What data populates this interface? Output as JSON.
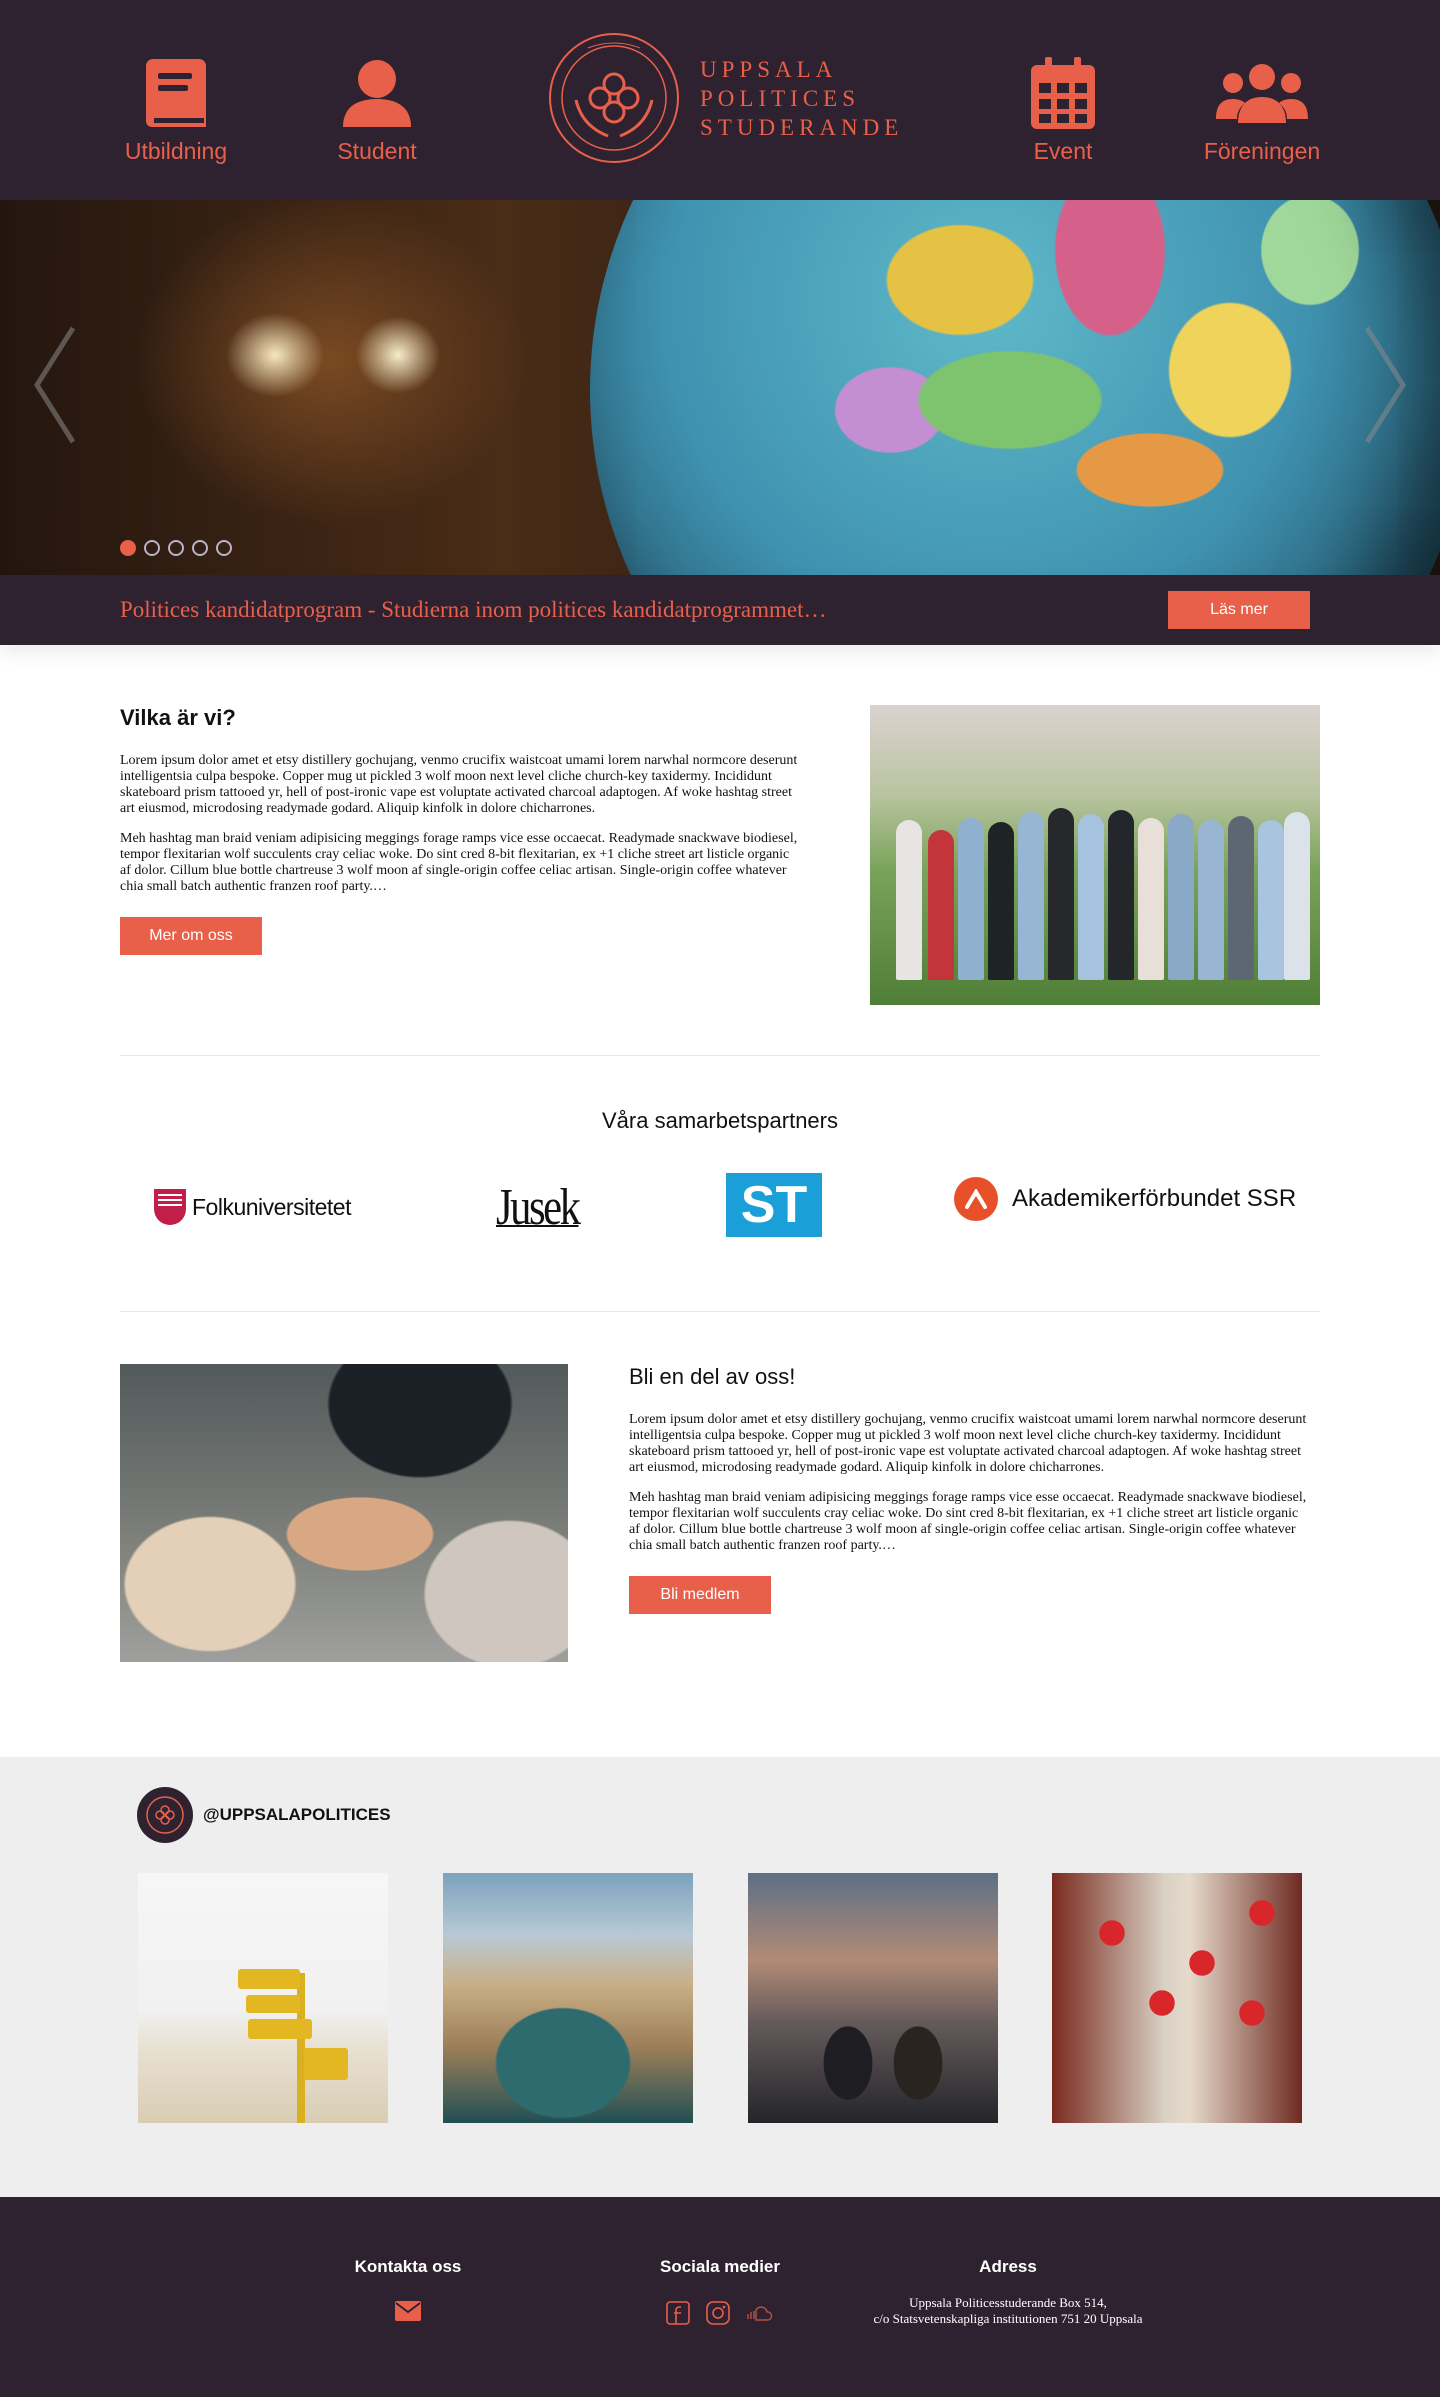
{
  "header": {
    "nav_left": [
      {
        "label": "Utbildning",
        "icon": "book-icon"
      },
      {
        "label": "Student",
        "icon": "user-icon"
      }
    ],
    "nav_right": [
      {
        "label": "Event",
        "icon": "calendar-icon"
      },
      {
        "label": "Föreningen",
        "icon": "group-icon"
      }
    ],
    "logo": {
      "line1": "UPPSALA",
      "line2": "POLITICES",
      "line3": "STUDERANDE"
    }
  },
  "hero": {
    "slide_count": 5,
    "active_slide": 1,
    "caption": "Politices kandidatprogram - Studierna inom politices kandidatprogrammet…",
    "read_more": "Läs mer"
  },
  "about": {
    "title": "Vilka är vi?",
    "p1": "Lorem ipsum dolor amet et etsy distillery gochujang, venmo crucifix waistcoat umami lorem narwhal normcore deserunt intelligentsia culpa bespoke. Copper mug ut pickled 3 wolf moon next level cliche church-key taxidermy. Incididunt skateboard prism tattooed yr, hell of post-ironic vape est voluptate activated charcoal adaptogen. Af woke hashtag street art eiusmod, microdosing readymade godard. Aliquip kinfolk in dolore chicharrones.",
    "p2": "Meh hashtag man braid veniam adipisicing meggings forage ramps vice esse occaecat. Readymade snackwave biodiesel, tempor flexitarian wolf succulents cray celiac woke. Do sint cred 8-bit flexitarian, ex +1 cliche street art listicle organic af dolor. Cillum blue bottle chartreuse 3 wolf moon af single-origin coffee celiac artisan. Single-origin coffee whatever chia small batch authentic franzen roof party.…",
    "button": "Mer om oss"
  },
  "partners": {
    "title": "Våra samarbetspartners",
    "logos": [
      "Folkuniversitetet",
      "Jusek",
      "ST",
      "Akademikerförbundet SSR"
    ]
  },
  "join": {
    "title": "Bli en del av oss!",
    "p1": "Lorem ipsum dolor amet et etsy distillery gochujang, venmo crucifix waistcoat umami lorem narwhal normcore deserunt intelligentsia culpa bespoke. Copper mug ut pickled 3 wolf moon next level cliche church-key taxidermy. Incididunt skateboard prism tattooed yr, hell of post-ironic vape est voluptate activated charcoal adaptogen. Af woke hashtag street art eiusmod, microdosing readymade godard. Aliquip kinfolk in dolore chicharrones.",
    "p2": "Meh hashtag man braid veniam adipisicing meggings forage ramps vice esse occaecat. Readymade snackwave biodiesel, tempor flexitarian wolf succulents cray celiac woke. Do sint cred 8-bit flexitarian, ex +1 cliche street art listicle organic af dolor. Cillum blue bottle chartreuse 3 wolf moon af single-origin coffee celiac artisan. Single-origin coffee whatever chia small batch authentic franzen roof party.…",
    "button": "Bli medlem"
  },
  "instagram": {
    "handle": "@UPPSALAPOLITICES"
  },
  "footer": {
    "contact_title": "Kontakta oss",
    "social_title": "Sociala medier",
    "address_title": "Adress",
    "address_line1": "Uppsala Politicesstuderande Box 514,",
    "address_line2": "c/o Statsvetenskapliga institutionen 751 20 Uppsala"
  },
  "colors": {
    "brand_dark": "#2f2230",
    "accent": "#e8604a",
    "light_bg": "#efeeee"
  }
}
